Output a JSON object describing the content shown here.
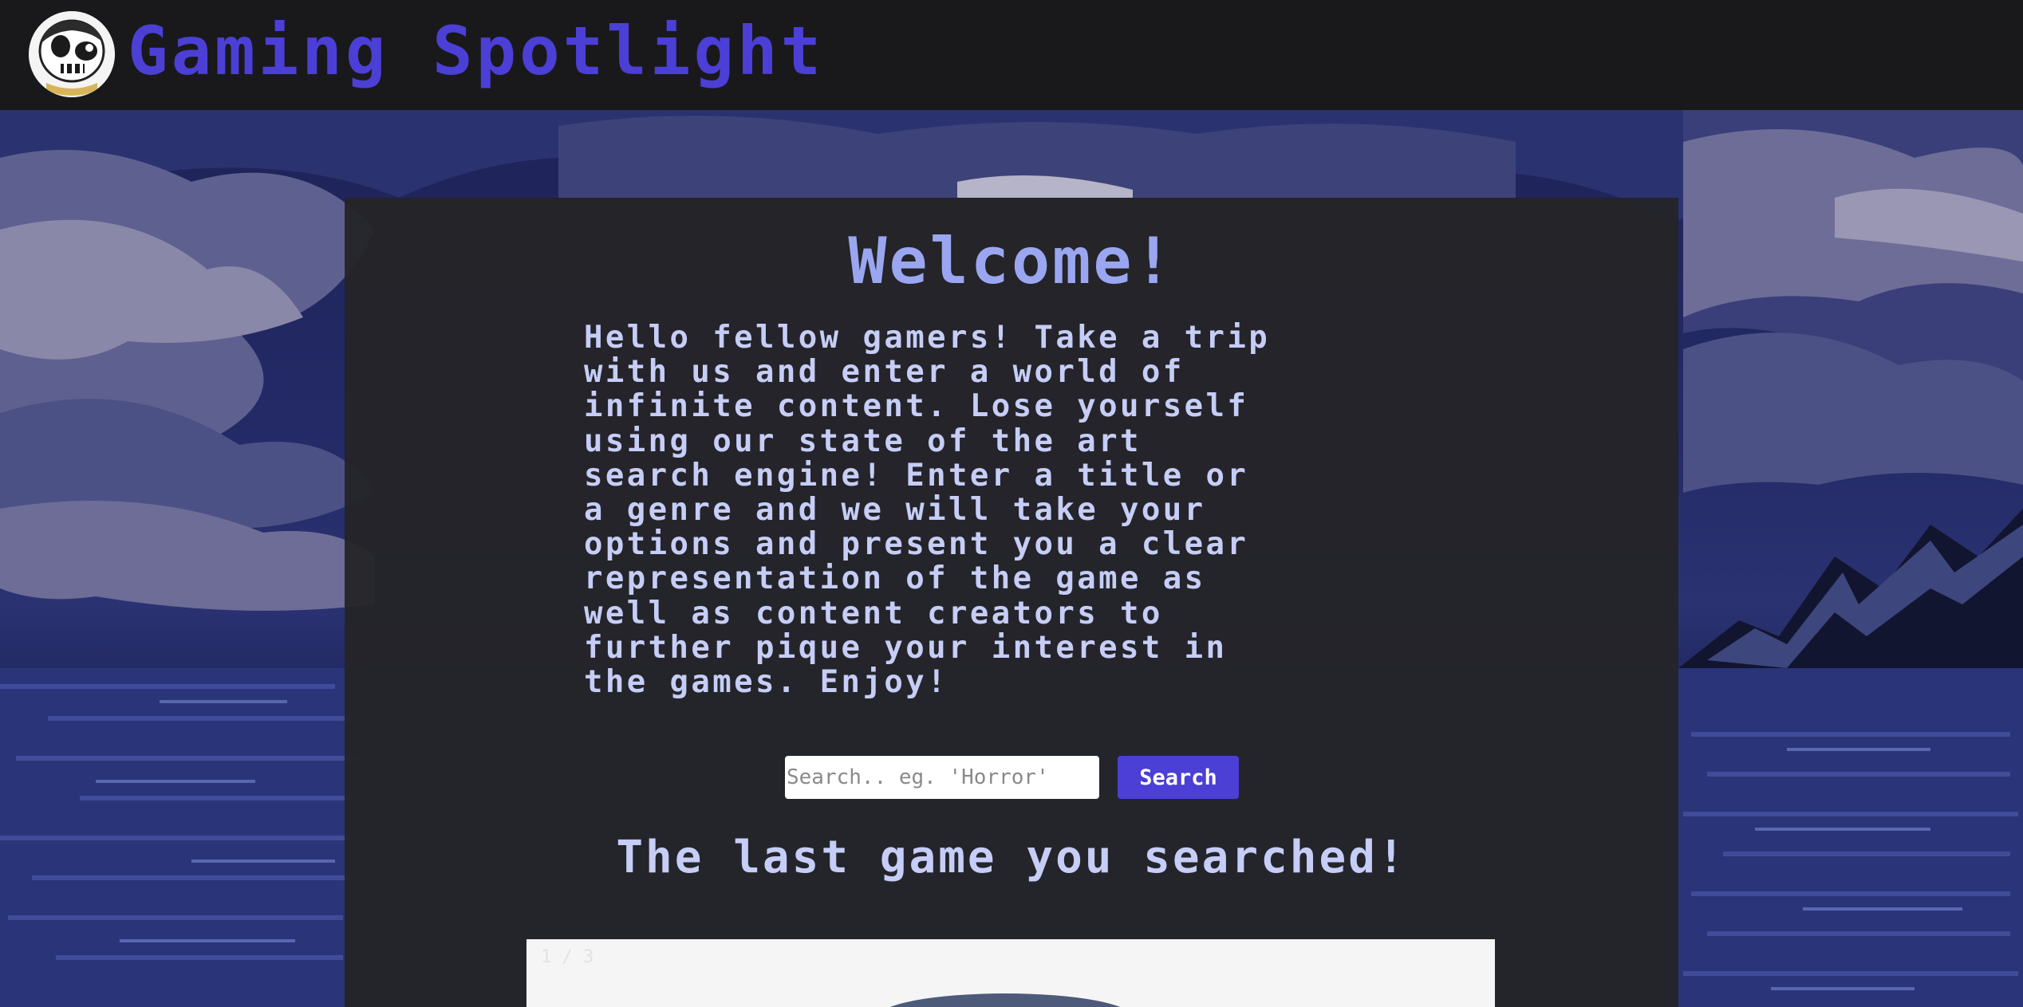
{
  "header": {
    "logo_icon": "skull-mascot-icon",
    "title": "Gaming Spotlight"
  },
  "colors": {
    "accent": "#4b3fd6",
    "heading": "#9aa6ef",
    "text": "#c6cdf6",
    "panel": "#242426",
    "topbar": "#19191b"
  },
  "main": {
    "welcome": "Welcome!",
    "intro": "Hello fellow gamers! Take a trip\nwith us and enter a world of\ninfinite content. Lose yourself\nusing our state of the art\nsearch engine! Enter a title or\na genre and we will take your\noptions and present you a clear\nrepresentation of the game as\nwell as content creators to\nfurther pique your interest in\nthe games. Enjoy!",
    "search": {
      "placeholder": "Search.. eg. 'Horror'",
      "value": "",
      "button_label": "Search"
    },
    "last_searched_heading": "The last game you searched!",
    "carousel": {
      "counter": "1 / 3"
    }
  }
}
